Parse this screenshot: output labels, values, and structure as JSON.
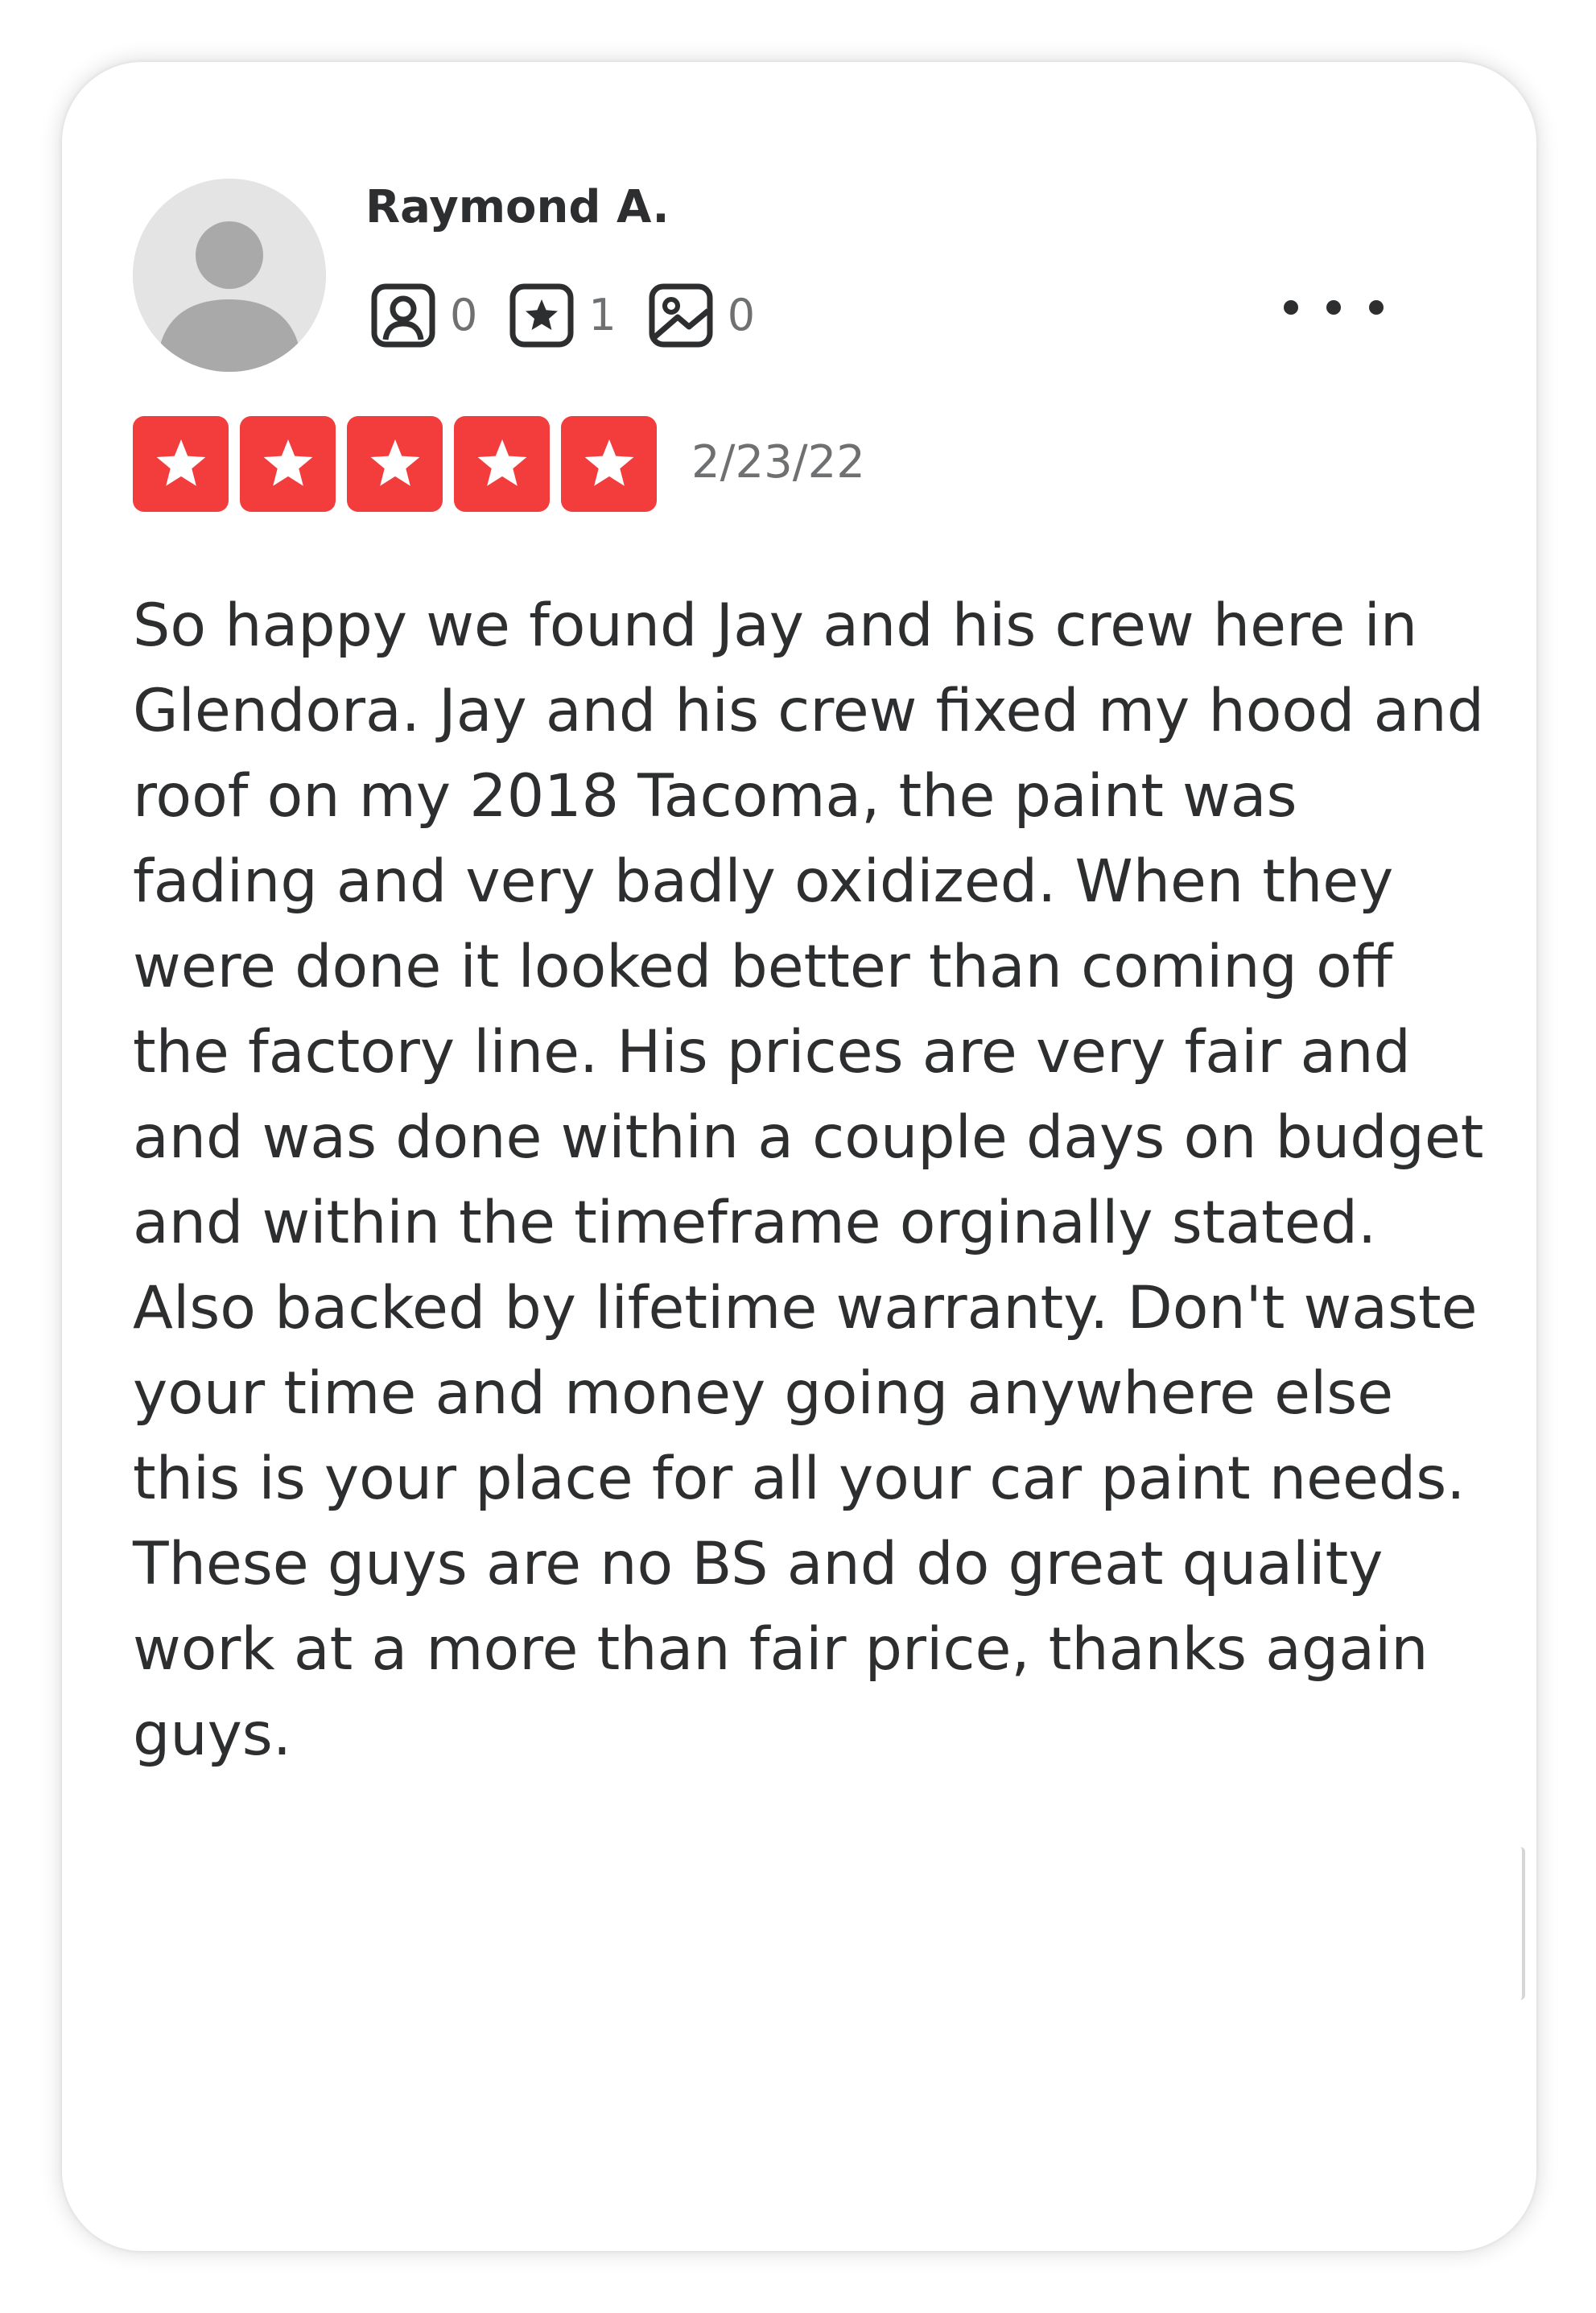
{
  "review": {
    "author": {
      "name": "Raymond A.",
      "avatar": "default-user-avatar"
    },
    "stats": {
      "friends": "0",
      "reviews": "1",
      "photos": "0"
    },
    "rating": 5,
    "rating_max": 5,
    "date": "2/23/22",
    "text": "So happy we found Jay and his crew here in Glendora. Jay and his crew fixed my hood and roof on my 2018 Tacoma, the paint was fading and very badly oxidized. When they were done it looked better than coming off the factory line. His prices are very fair and and was done within a couple days on budget and within the timeframe orginally stated. Also backed by lifetime warranty. Don't waste your time and money going anywhere else this is your place for all your car paint needs. These guys are no BS and do great quality work at a more than fair price, thanks again guys.",
    "more_icon": "more-horizontal-icon"
  },
  "colors": {
    "star_fill": "#f33d3d",
    "text": "#2d2e2f",
    "muted": "#6e7072"
  }
}
